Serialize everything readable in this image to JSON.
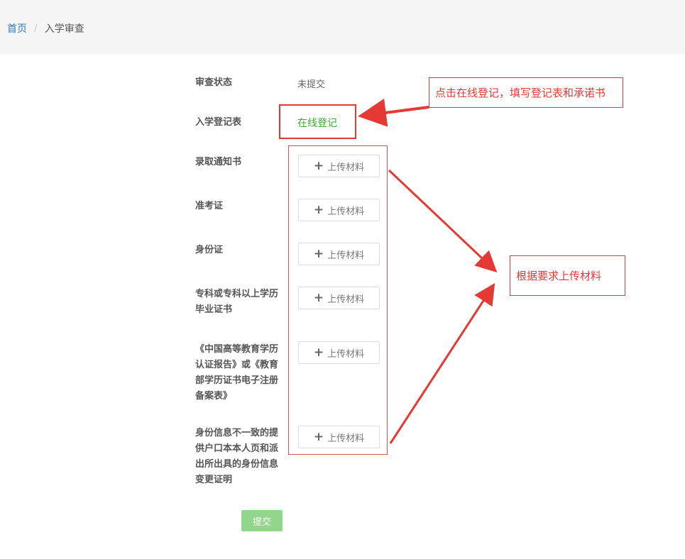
{
  "breadcrumb": {
    "home": "首页",
    "separator": "/",
    "current": "入学审查"
  },
  "form": {
    "status_label": "审查状态",
    "status_value": "未提交",
    "registration_label": "入学登记表",
    "registration_link": "在线登记",
    "uploads": [
      {
        "label": "录取通知书",
        "button": "上传材料"
      },
      {
        "label": "准考证",
        "button": "上传材料"
      },
      {
        "label": "身份证",
        "button": "上传材料"
      },
      {
        "label": "专科或专科以上学历毕业证书",
        "button": "上传材料"
      },
      {
        "label": "《中国高等教育学历认证报告》或《教育部学历证书电子注册备案表》",
        "button": "上传材料"
      },
      {
        "label": "身份信息不一致的提供户口本本人页和派出所出具的身份信息变更证明",
        "button": "上传材料"
      }
    ],
    "submit": "提交"
  },
  "annotations": {
    "callout_register": "点击在线登记，填写登记表和承诺书",
    "callout_upload": "根据要求上传材料",
    "color": "#e53935"
  },
  "colors": {
    "link": "#337ab7",
    "green_text": "#3aaa35",
    "submit_bg": "#92d68e",
    "header_bg": "#f5f5f5"
  }
}
